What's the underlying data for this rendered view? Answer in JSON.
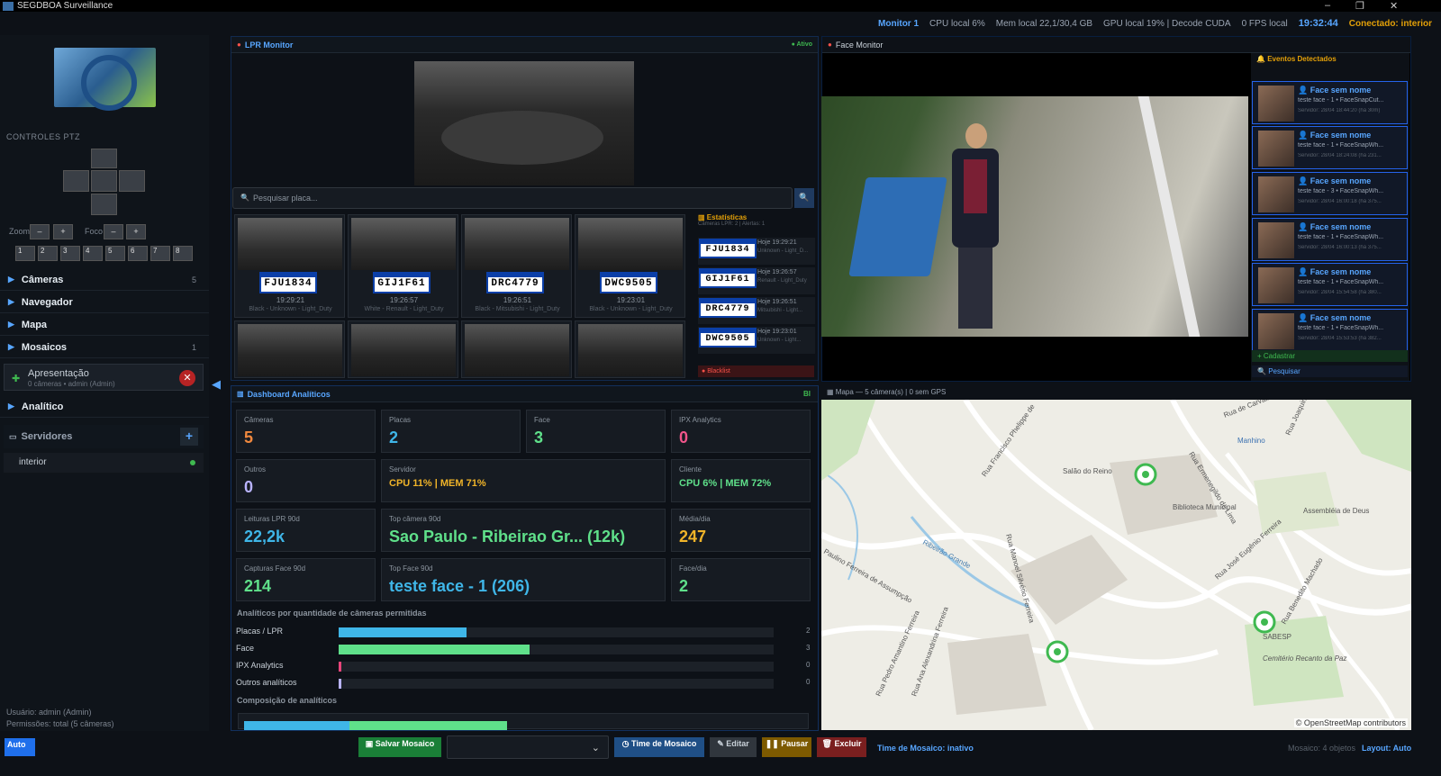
{
  "window": {
    "title": "SEGDBOA Surveillance",
    "controls": [
      "–",
      "❐",
      "✕"
    ]
  },
  "status": {
    "monitor": "Monitor 1",
    "cpu": "CPU local 6%",
    "mem": "Mem local 22,1/30,4 GB",
    "gpu": "GPU local 19% | Decode CUDA",
    "fps": "0 FPS local",
    "clock": "19:32:44",
    "conn": "Conectado: interior"
  },
  "sidebar": {
    "ptz_title": "CONTROLES PTZ",
    "zoom_label": "Zoom",
    "focus_label": "Foco",
    "minus": "–",
    "plus": "+",
    "presets": [
      "1",
      "2",
      "3",
      "4",
      "5",
      "6",
      "7",
      "8"
    ],
    "menu": [
      {
        "label": "Câmeras",
        "count": "5"
      },
      {
        "label": "Navegador",
        "count": ""
      },
      {
        "label": "Mapa",
        "count": ""
      },
      {
        "label": "Mosaicos",
        "count": "1"
      }
    ],
    "presentation": {
      "title": "Apresentação",
      "sub": "0 câmeras • admin (Admin)",
      "close": "✕"
    },
    "analitico": "Analítico",
    "servers": {
      "label": "Servidores",
      "add": "+",
      "item": "interior"
    },
    "user": "Usuário: admin (Admin)",
    "perm": "Permissões: total (5 câmeras)"
  },
  "lpr": {
    "title": "LPR Monitor",
    "status": "Ativo",
    "search_placeholder": "Pesquisar placa...",
    "search_icon": "🔍",
    "thumbs": [
      {
        "plate": "FJU1834",
        "time": "19:29:21",
        "desc": "Black - Unknown - Light_Duty"
      },
      {
        "plate": "GIJ1F61",
        "time": "19:26:57",
        "desc": "White - Renault - Light_Duty"
      },
      {
        "plate": "DRC4779",
        "time": "19:26:51",
        "desc": "Black - Mitsubishi - Light_Duty"
      },
      {
        "plate": "DWC9505",
        "time": "19:23:01",
        "desc": "Black - Unknown - Light_Duty"
      }
    ],
    "stats": {
      "title": "Estatísticas",
      "sub": "Câmeras LPR: 2 | Alertas: 1",
      "rows": [
        {
          "plate": "FJU1834",
          "time": "Hoje 19:29:21",
          "desc": "Unknown - Light_D..."
        },
        {
          "plate": "GIJ1F61",
          "time": "Hoje 19:26:57",
          "desc": "Renault - Light_Duty"
        },
        {
          "plate": "DRC4779",
          "time": "Hoje 19:26:51",
          "desc": "Mitsubishi - Light..."
        },
        {
          "plate": "DWC9505",
          "time": "Hoje 19:23:01",
          "desc": "Unknown - Light..."
        }
      ],
      "blacklist": "Blacklist"
    }
  },
  "face": {
    "title": "Face Monitor",
    "events_title": "Eventos Detectados",
    "events": [
      {
        "name": "Face sem nome",
        "src": "teste face - 1 • FaceSnapCut...",
        "date": "Servidor: 28/04 18:44:20 (há 30m)"
      },
      {
        "name": "Face sem nome",
        "src": "teste face - 1 • FaceSnapWh...",
        "date": "Servidor: 28/04 18:24:08 (há 231..."
      },
      {
        "name": "Face sem nome",
        "src": "teste face - 3 • FaceSnapWh...",
        "date": "Servidor: 28/04 16:00:18 (há 375..."
      },
      {
        "name": "Face sem nome",
        "src": "teste face - 1 • FaceSnapWh...",
        "date": "Servidor: 28/04 16:00:13 (há 375..."
      },
      {
        "name": "Face sem nome",
        "src": "teste face - 1 • FaceSnapWh...",
        "date": "Servidor: 28/04 15:54:58 (há 380..."
      },
      {
        "name": "Face sem nome",
        "src": "teste face - 1 • FaceSnapWh...",
        "date": "Servidor: 28/04 15:53:53 (há 382..."
      }
    ],
    "register": "Cadastrar",
    "search": "Pesquisar"
  },
  "dashboard": {
    "title": "Dashboard Analíticos",
    "badge": "BI",
    "cards": {
      "cameras": {
        "label": "Câmeras",
        "value": "5"
      },
      "placas": {
        "label": "Placas",
        "value": "2"
      },
      "face": {
        "label": "Face",
        "value": "3"
      },
      "ipx": {
        "label": "IPX Analytics",
        "value": "0"
      },
      "outros": {
        "label": "Outros",
        "value": "0"
      },
      "servidor": {
        "label": "Servidor",
        "value": "CPU 11% | MEM 71%"
      },
      "cliente": {
        "label": "Cliente",
        "value": "CPU 6% | MEM 72%"
      },
      "lpr90": {
        "label": "Leituras LPR 90d",
        "value": "22,2k"
      },
      "topcam": {
        "label": "Top câmera 90d",
        "value": "Sao Paulo - Ribeirao Gr... (12k)"
      },
      "media": {
        "label": "Média/dia",
        "value": "247"
      },
      "face90": {
        "label": "Capturas Face 90d",
        "value": "214"
      },
      "topface": {
        "label": "Top Face 90d",
        "value": "teste face - 1 (206)"
      },
      "facedia": {
        "label": "Face/dia",
        "value": "2"
      }
    },
    "bars_title": "Analíticos por quantidade de câmeras permitidas",
    "bars": [
      {
        "label": "Placas / LPR",
        "value": 2,
        "color": "#3fb6e8"
      },
      {
        "label": "Face",
        "value": 3,
        "color": "#5fe08a"
      },
      {
        "label": "IPX Analytics",
        "value": 0,
        "color": "#e8457a"
      },
      {
        "label": "Outros analíticos",
        "value": 0,
        "color": "#b9b3ff"
      }
    ],
    "bars_max": 10,
    "comp_title": "Composição de analíticos"
  },
  "map": {
    "title": "Mapa — 5 câmera(s) | 0 sem GPS",
    "attribution": "© OpenStreetMap contributors",
    "labels": [
      "Rua Francisco Phelippe de",
      "Salão do Reino",
      "Biblioteca Municipal",
      "Assembléia de Deus",
      "Rua Ermenegildo de Lima",
      "Ribeirão Grande",
      "Rua Manoel Silvério Ferreira",
      "Rua José Eugênio Ferreira",
      "Rua Benedito Machado",
      "Paulino Ferreira de Assumpção",
      "Rua Pedro Amantino Ferreira",
      "Rua Ana Alexandrina Ferreira",
      "Cemitério Recanto da Paz",
      "SABESP",
      "Manhino",
      "Rua de Carvalho",
      "Rua Joaquim"
    ]
  },
  "bottom": {
    "auto": "Auto",
    "save": "Salvar Mosaico",
    "timer": "Time de Mosaico",
    "edit": "Editar",
    "pause": "Pausar",
    "delete": "Excluir",
    "timer_status": "Time de Mosaico: inativo",
    "mosaic_info": "Mosaico: 4 objetos",
    "layout": "Layout: Auto"
  }
}
